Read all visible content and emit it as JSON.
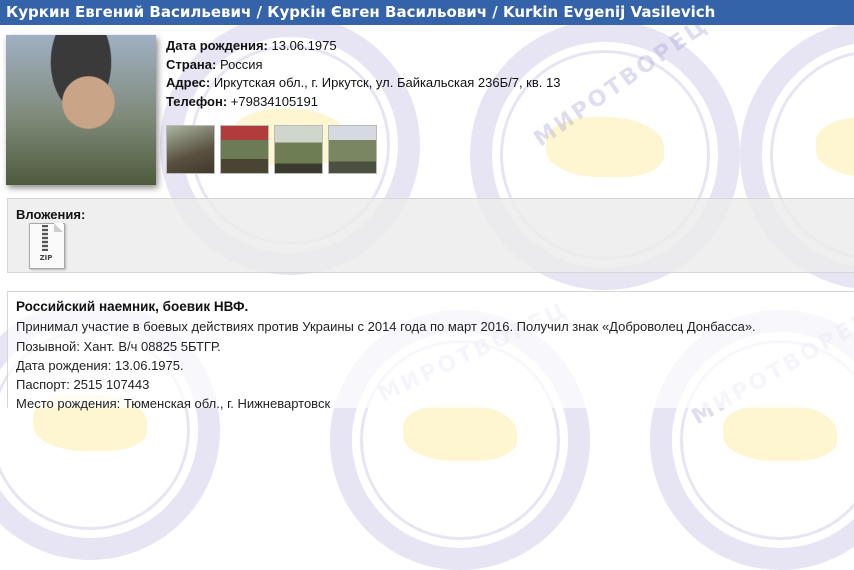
{
  "header": {
    "title": "Куркин Евгений Васильевич / Куркін Євген Васильович / Kurkin Evgenij Vasilevich"
  },
  "profile": {
    "fields": [
      {
        "label": "Дата рождения:",
        "value": "13.06.1975"
      },
      {
        "label": "Страна:",
        "value": "Россия"
      },
      {
        "label": "Адрес:",
        "value": "Иркутская обл., г. Иркутск, ул. Байкальская 236Б/7, кв. 13"
      },
      {
        "label": "Телефон:",
        "value": "+79834105191"
      }
    ]
  },
  "attachments": {
    "title": "Вложения:",
    "file_type": "ZIP",
    "file_icon": "zip-file-icon"
  },
  "description": {
    "heading": "Российский наемник, боевик НВФ.",
    "lines": [
      "Принимал участие в боевых действиях против Украины с 2014 года по март 2016. Получил знак «Доброволец Донбасса».",
      "Позывной: Хант. В/ч 08825 5БТГР.",
      "Дата рождения: 13.06.1975.",
      "Паспорт: 2515 107443",
      "Место рождения: Тюменская обл., г. Нижневартовск"
    ]
  },
  "watermark": {
    "text": "МИРОТВОРЕЦ"
  },
  "colors": {
    "header_bg": "#3563a9",
    "header_text": "#ffffff"
  }
}
